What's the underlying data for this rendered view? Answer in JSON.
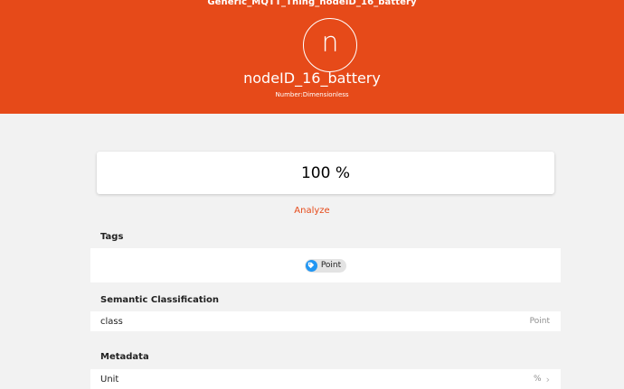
{
  "header": {
    "thing_title": "Generic_MQTT_Thing_nodeID_16_battery",
    "avatar_letter": "n",
    "item_name": "nodeID_16_battery",
    "item_type": "Number:Dimensionless",
    "bg_color": "#e64a19"
  },
  "state": {
    "value": "100 %"
  },
  "analyze": {
    "label": "Analyze",
    "color": "#e64a19"
  },
  "tags": {
    "title": "Tags",
    "items": [
      {
        "label": "Point",
        "icon": "tag-icon",
        "icon_color": "#2196f3"
      }
    ]
  },
  "semantic": {
    "title": "Semantic Classification",
    "rows": [
      {
        "label": "class",
        "value": "Point"
      }
    ]
  },
  "metadata": {
    "title": "Metadata",
    "rows": [
      {
        "label": "Unit",
        "value": "%",
        "icon": "chevron-right-icon"
      }
    ]
  }
}
